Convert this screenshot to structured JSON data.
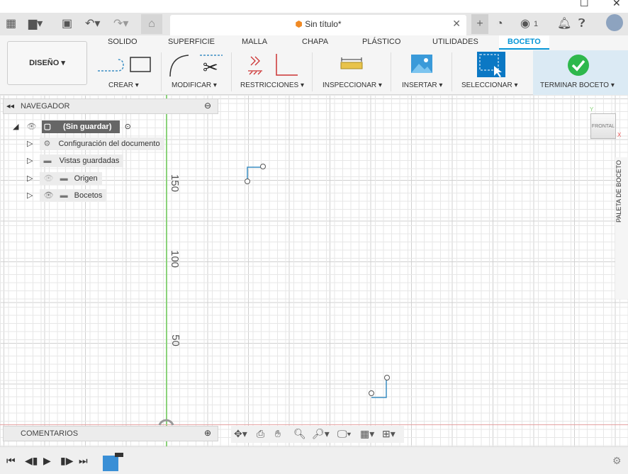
{
  "window": {
    "maximize": "☐",
    "close": "✕"
  },
  "appbar": {
    "doc_title": "Sin título*",
    "close": "✕",
    "notif_count": "1",
    "add": "+"
  },
  "tabs": [
    {
      "label": "SOLIDO"
    },
    {
      "label": "SUPERFICIE"
    },
    {
      "label": "MALLA"
    },
    {
      "label": "CHAPA"
    },
    {
      "label": "PLÁSTICO"
    },
    {
      "label": "UTILIDADES"
    },
    {
      "label": "BOCETO"
    }
  ],
  "active_tab": "BOCETO",
  "design": {
    "label": "DISEÑO ▾"
  },
  "groups": {
    "crear": "CREAR ▾",
    "modificar": "MODIFICAR ▾",
    "restricciones": "RESTRICCIONES ▾",
    "inspeccionar": "INSPECCIONAR ▾",
    "insertar": "INSERTAR ▾",
    "seleccionar": "SELECCIONAR ▾",
    "terminar": "TERMINAR BOCETO ▾"
  },
  "navigator": {
    "title": "NAVEGADOR",
    "root": "(Sin guardar)",
    "items": [
      {
        "label": "Configuración del documento"
      },
      {
        "label": "Vistas guardadas"
      },
      {
        "label": "Origen"
      },
      {
        "label": "Bocetos"
      }
    ]
  },
  "comments": {
    "title": "COMENTARIOS"
  },
  "axis_labels": {
    "a": "150",
    "b": "100",
    "c": "50"
  },
  "viewcube": {
    "label": "FRONTAL"
  },
  "palette": {
    "label": "PALETA DE BOCETO"
  },
  "colors": {
    "accent": "#0696d7",
    "finish": "#2eb84c",
    "axis_green": "#8bd37b",
    "axis_red": "#e5a1a1",
    "sketch": "#3c8fc4"
  }
}
